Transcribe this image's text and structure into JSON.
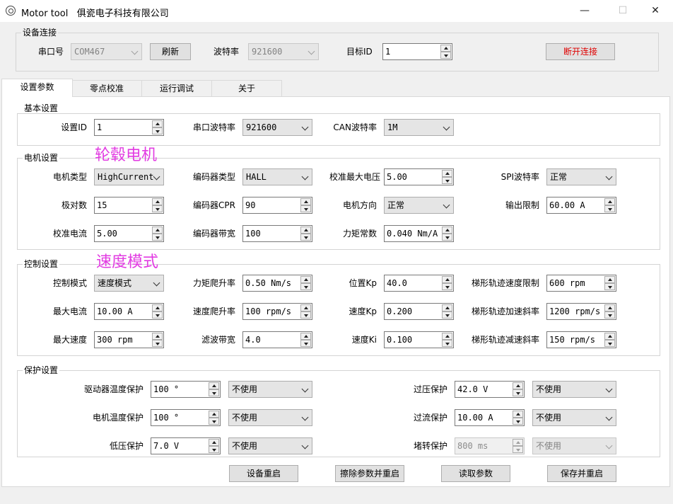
{
  "window": {
    "app_name": "Motor tool",
    "company": "俱瓷电子科技有限公司",
    "minimize": "—",
    "maximize": "☐",
    "close": "✕"
  },
  "connection": {
    "group_title": "设备连接",
    "port_label": "串口号",
    "port_value": "COM467",
    "refresh_label": "刷新",
    "baud_label": "波特率",
    "baud_value": "921600",
    "target_id_label": "目标ID",
    "target_id_value": "1",
    "disconnect_label": "断开连接"
  },
  "tabs": [
    {
      "label": "设置参数",
      "active": true
    },
    {
      "label": "零点校准",
      "active": false
    },
    {
      "label": "运行调试",
      "active": false
    },
    {
      "label": "关于",
      "active": false
    }
  ],
  "basic": {
    "group_title": "基本设置",
    "set_id_label": "设置ID",
    "set_id_value": "1",
    "serial_baud_label": "串口波特率",
    "serial_baud_value": "921600",
    "can_baud_label": "CAN波特率",
    "can_baud_value": "1M"
  },
  "motor": {
    "group_title": "电机设置",
    "annotation": "轮毂电机",
    "motor_type_label": "电机类型",
    "motor_type_value": "HighCurrent",
    "encoder_type_label": "编码器类型",
    "encoder_type_value": "HALL",
    "cal_max_voltage_label": "校准最大电压",
    "cal_max_voltage_value": "5.00",
    "spi_baud_label": "SPI波特率",
    "spi_baud_value": "正常",
    "pole_pairs_label": "极对数",
    "pole_pairs_value": "15",
    "encoder_cpr_label": "编码器CPR",
    "encoder_cpr_value": "90",
    "motor_dir_label": "电机方向",
    "motor_dir_value": "正常",
    "output_limit_label": "输出限制",
    "output_limit_value": "60.00 A",
    "cal_current_label": "校准电流",
    "cal_current_value": "5.00",
    "encoder_bw_label": "编码器带宽",
    "encoder_bw_value": "100",
    "torque_const_label": "力矩常数",
    "torque_const_value": "0.040 Nm/A"
  },
  "control": {
    "group_title": "控制设置",
    "annotation": "速度模式",
    "mode_label": "控制模式",
    "mode_value": "速度模式",
    "torque_ramp_label": "力矩爬升率",
    "torque_ramp_value": "0.50 Nm/s",
    "pos_kp_label": "位置Kp",
    "pos_kp_value": "40.0",
    "traj_vel_limit_label": "梯形轨迹速度限制",
    "traj_vel_limit_value": "600 rpm",
    "max_current_label": "最大电流",
    "max_current_value": "10.00 A",
    "vel_ramp_label": "速度爬升率",
    "vel_ramp_value": "100 rpm/s",
    "vel_kp_label": "速度Kp",
    "vel_kp_value": "0.200",
    "traj_accel_label": "梯形轨迹加速斜率",
    "traj_accel_value": "1200 rpm/s",
    "max_speed_label": "最大速度",
    "max_speed_value": "300 rpm",
    "filter_bw_label": "滤波带宽",
    "filter_bw_value": "4.0",
    "vel_ki_label": "速度Ki",
    "vel_ki_value": "0.100",
    "traj_decel_label": "梯形轨迹减速斜率",
    "traj_decel_value": "150 rpm/s"
  },
  "protection": {
    "group_title": "保护设置",
    "driver_temp_label": "驱动器温度保护",
    "driver_temp_value": "100 °",
    "driver_temp_mode": "不使用",
    "overvolt_label": "过压保护",
    "overvolt_value": "42.0 V",
    "overvolt_mode": "不使用",
    "motor_temp_label": "电机温度保护",
    "motor_temp_value": "100 °",
    "motor_temp_mode": "不使用",
    "overcurrent_label": "过流保护",
    "overcurrent_value": "10.00 A",
    "overcurrent_mode": "不使用",
    "undervolt_label": "低压保护",
    "undervolt_value": "7.0 V",
    "undervolt_mode": "不使用",
    "stall_label": "堵转保护",
    "stall_value": "800 ms",
    "stall_mode": "不使用"
  },
  "actions": {
    "restart_label": "设备重启",
    "erase_label": "擦除参数并重启",
    "read_label": "读取参数",
    "save_label": "保存并重启"
  }
}
